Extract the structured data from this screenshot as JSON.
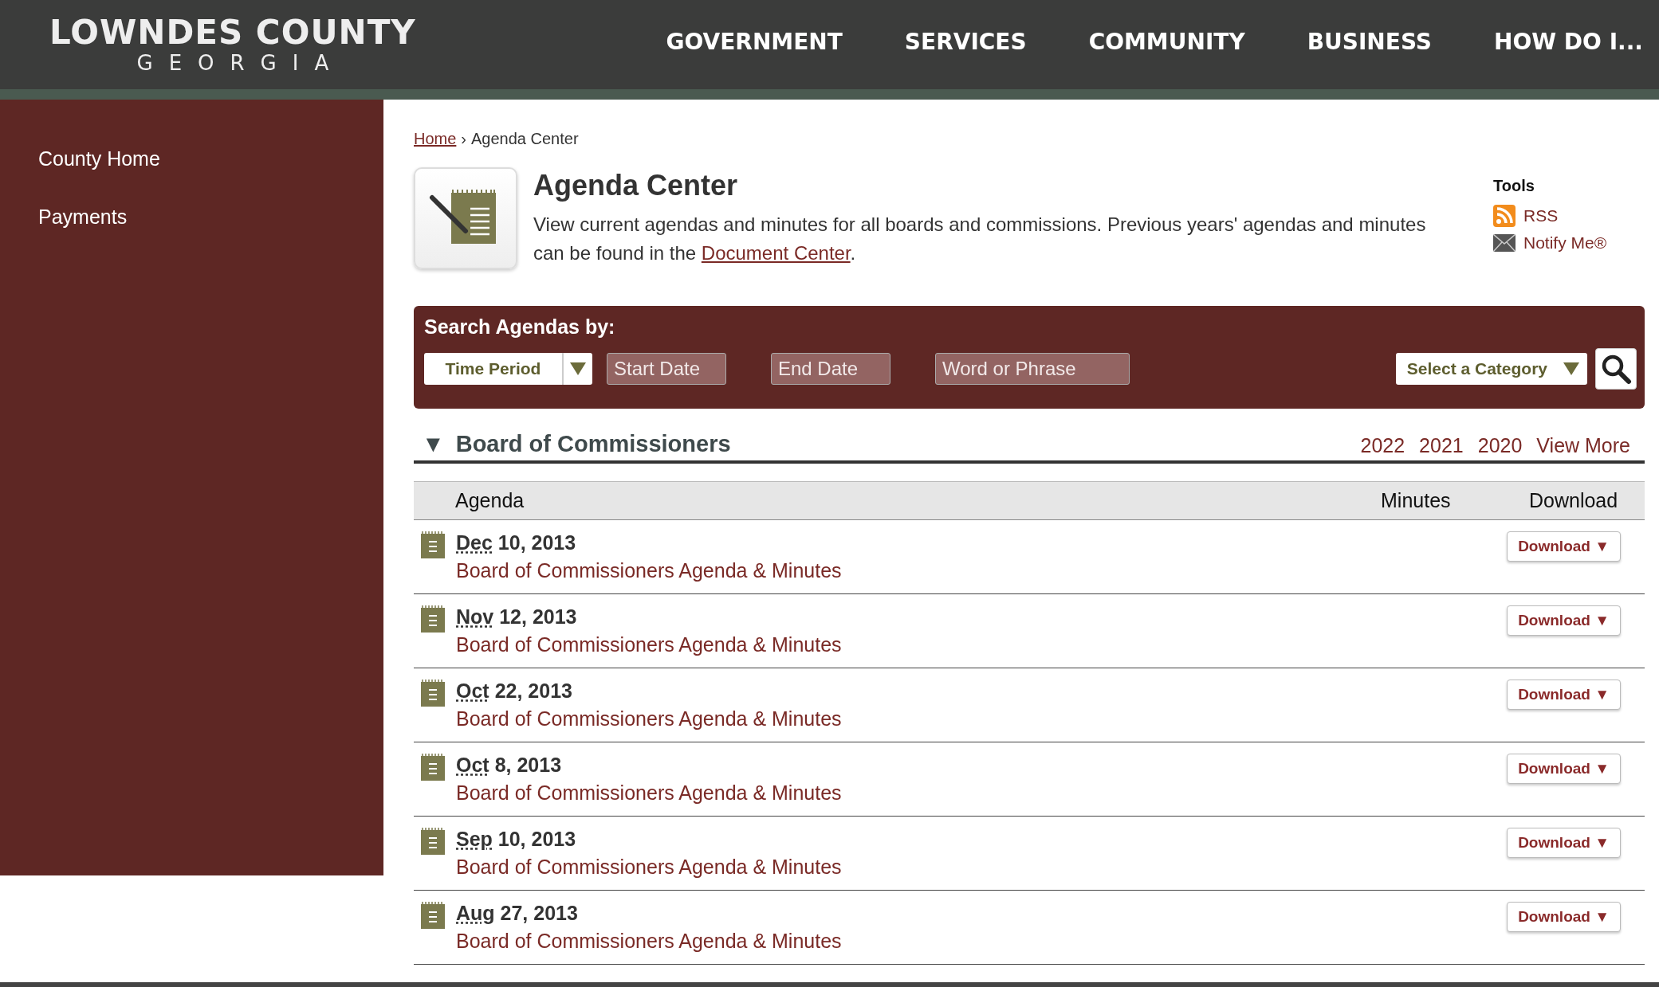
{
  "header": {
    "logo_title": "LOWNDES COUNTY",
    "logo_subtitle": "GEORGIA",
    "nav": [
      "GOVERNMENT",
      "SERVICES",
      "COMMUNITY",
      "BUSINESS",
      "HOW DO I..."
    ]
  },
  "sidebar": {
    "items": [
      "County Home",
      "Payments"
    ]
  },
  "breadcrumb": {
    "link": "Home",
    "separator": "›",
    "current": "Agenda Center"
  },
  "intro": {
    "title": "Agenda Center",
    "text": "View current agendas and minutes for all boards and commissions. Previous years' agendas and minutes can be found in the ",
    "link": "Document Center",
    "after": "."
  },
  "tools": {
    "title": "Tools",
    "items": [
      {
        "kind": "rss",
        "label": "RSS"
      },
      {
        "kind": "mail",
        "label": "Notify Me®"
      }
    ]
  },
  "search": {
    "title": "Search Agendas by:",
    "time_period": "Time Period",
    "start_placeholder": "Start Date",
    "end_placeholder": "End Date",
    "word_placeholder": "Word or Phrase",
    "category": "Select a Category"
  },
  "section": {
    "title": "Board of Commissioners",
    "expanded": true,
    "toggle": "▼",
    "years": [
      "2022",
      "2021",
      "2020",
      "View More"
    ]
  },
  "table": {
    "columns": [
      "Agenda",
      "Minutes",
      "Download"
    ],
    "rows": [
      {
        "month": "Dec",
        "rest": " 10, 2013",
        "title": "Board of Commissioners Agenda & Minutes",
        "download": "Download ▼"
      },
      {
        "month": "Nov",
        "rest": " 12, 2013",
        "title": "Board of Commissioners Agenda & Minutes",
        "download": "Download ▼"
      },
      {
        "month": "Oct",
        "rest": " 22, 2013",
        "title": "Board of Commissioners Agenda & Minutes",
        "download": "Download ▼"
      },
      {
        "month": "Oct",
        "rest": " 8, 2013",
        "title": "Board of Commissioners Agenda & Minutes",
        "download": "Download ▼"
      },
      {
        "month": "Sep",
        "rest": " 10, 2013",
        "title": "Board of Commissioners Agenda & Minutes",
        "download": "Download ▼"
      },
      {
        "month": "Aug",
        "rest": " 27, 2013",
        "title": "Board of Commissioners Agenda & Minutes",
        "download": "Download ▼"
      }
    ]
  }
}
